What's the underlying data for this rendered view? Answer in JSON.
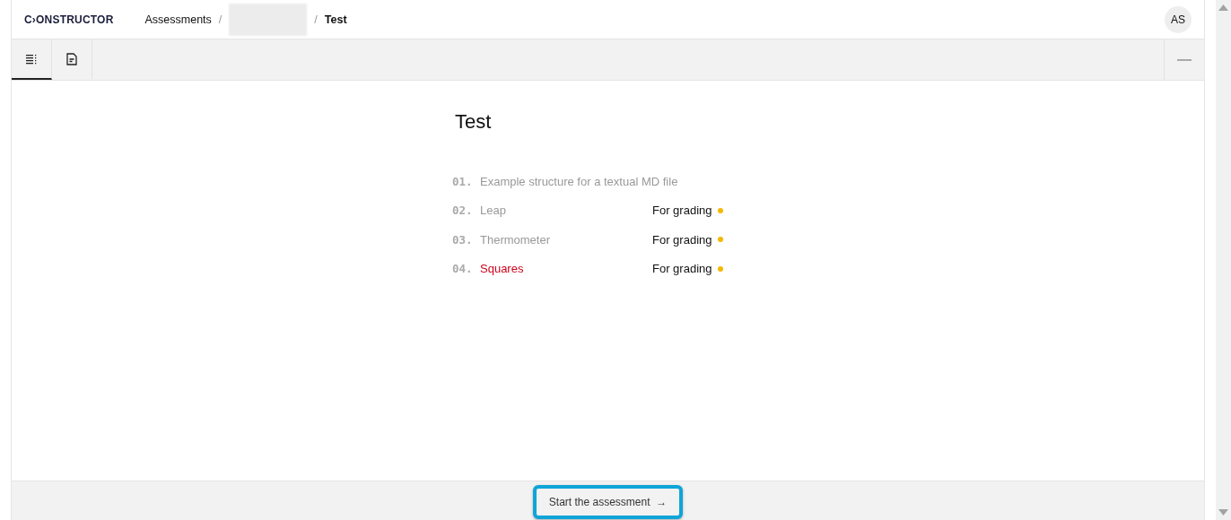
{
  "logo": "C›ONSTRUCTOR",
  "breadcrumbs": [
    {
      "kind": "link",
      "label": "Assessments"
    },
    {
      "kind": "blurred"
    },
    {
      "kind": "current",
      "label": "Test"
    }
  ],
  "breadcrumb_separators": [
    "/",
    "/"
  ],
  "avatar": "AS",
  "tabs": [
    {
      "kind": "outline",
      "selected": true
    },
    {
      "kind": "document",
      "selected": false
    }
  ],
  "title": "Test",
  "items": [
    {
      "number": "01.",
      "name": "Example structure for a textual MD file",
      "selected": false
    },
    {
      "number": "02.",
      "name": "Leap",
      "selected": false,
      "status": "For grading",
      "color": "#f5b800"
    },
    {
      "number": "03.",
      "name": "Thermometer",
      "selected": false,
      "status": "For grading",
      "color": "#f5b800"
    },
    {
      "number": "04.",
      "name": "Squares",
      "selected": true,
      "status": "For grading",
      "color": "#f5b800"
    }
  ],
  "start_button": {
    "label": "Start the assessment",
    "arrow": "→"
  }
}
